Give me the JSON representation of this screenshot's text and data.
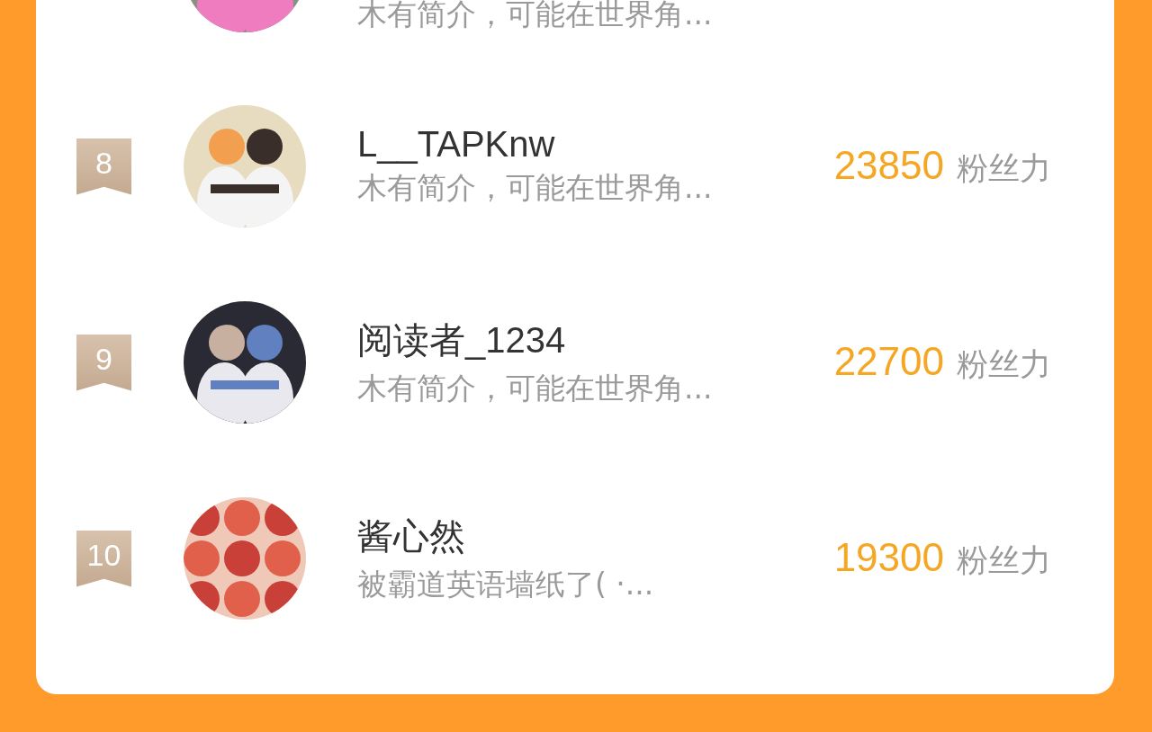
{
  "partial_row": {
    "intro": "木有简介，可能在世界角..."
  },
  "rows": [
    {
      "rank": "8",
      "name": "L__TAPKnw",
      "intro": "木有简介，可能在世界角...",
      "score": "23850",
      "unit": "粉丝力"
    },
    {
      "rank": "9",
      "name": "阅读者_1234",
      "intro": "木有简介，可能在世界角...",
      "score": "22700",
      "unit": "粉丝力"
    },
    {
      "rank": "10",
      "name": "酱心然",
      "intro": "被霸道英语墙纸了( ·...",
      "score": "19300",
      "unit": "粉丝力"
    }
  ]
}
